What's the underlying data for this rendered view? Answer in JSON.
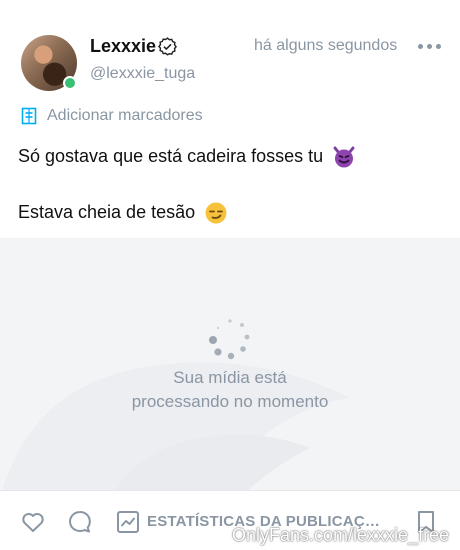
{
  "post": {
    "author_name": "Lexxxie",
    "author_handle": "@lexxxie_tuga",
    "timestamp": "há alguns segundos",
    "tags_label": "Adicionar marcadores",
    "text_line1": "Só gostava que está cadeira fosses tu",
    "text_line2": "Estava cheia de tesão",
    "emoji1": "smiling-devil",
    "emoji2": "smirking-face"
  },
  "media": {
    "processing_line1": "Sua mídia está",
    "processing_line2": "processando no momento"
  },
  "actions": {
    "stats_label": "ESTATÍSTICAS DA PUBLICAÇ…"
  },
  "watermark": {
    "text": "OnlyFans.com/lexxxie_free"
  },
  "colors": {
    "muted": "#8a96a3",
    "accent": "#00aff0",
    "online": "#38c172",
    "media_bg": "#f3f4f6"
  }
}
